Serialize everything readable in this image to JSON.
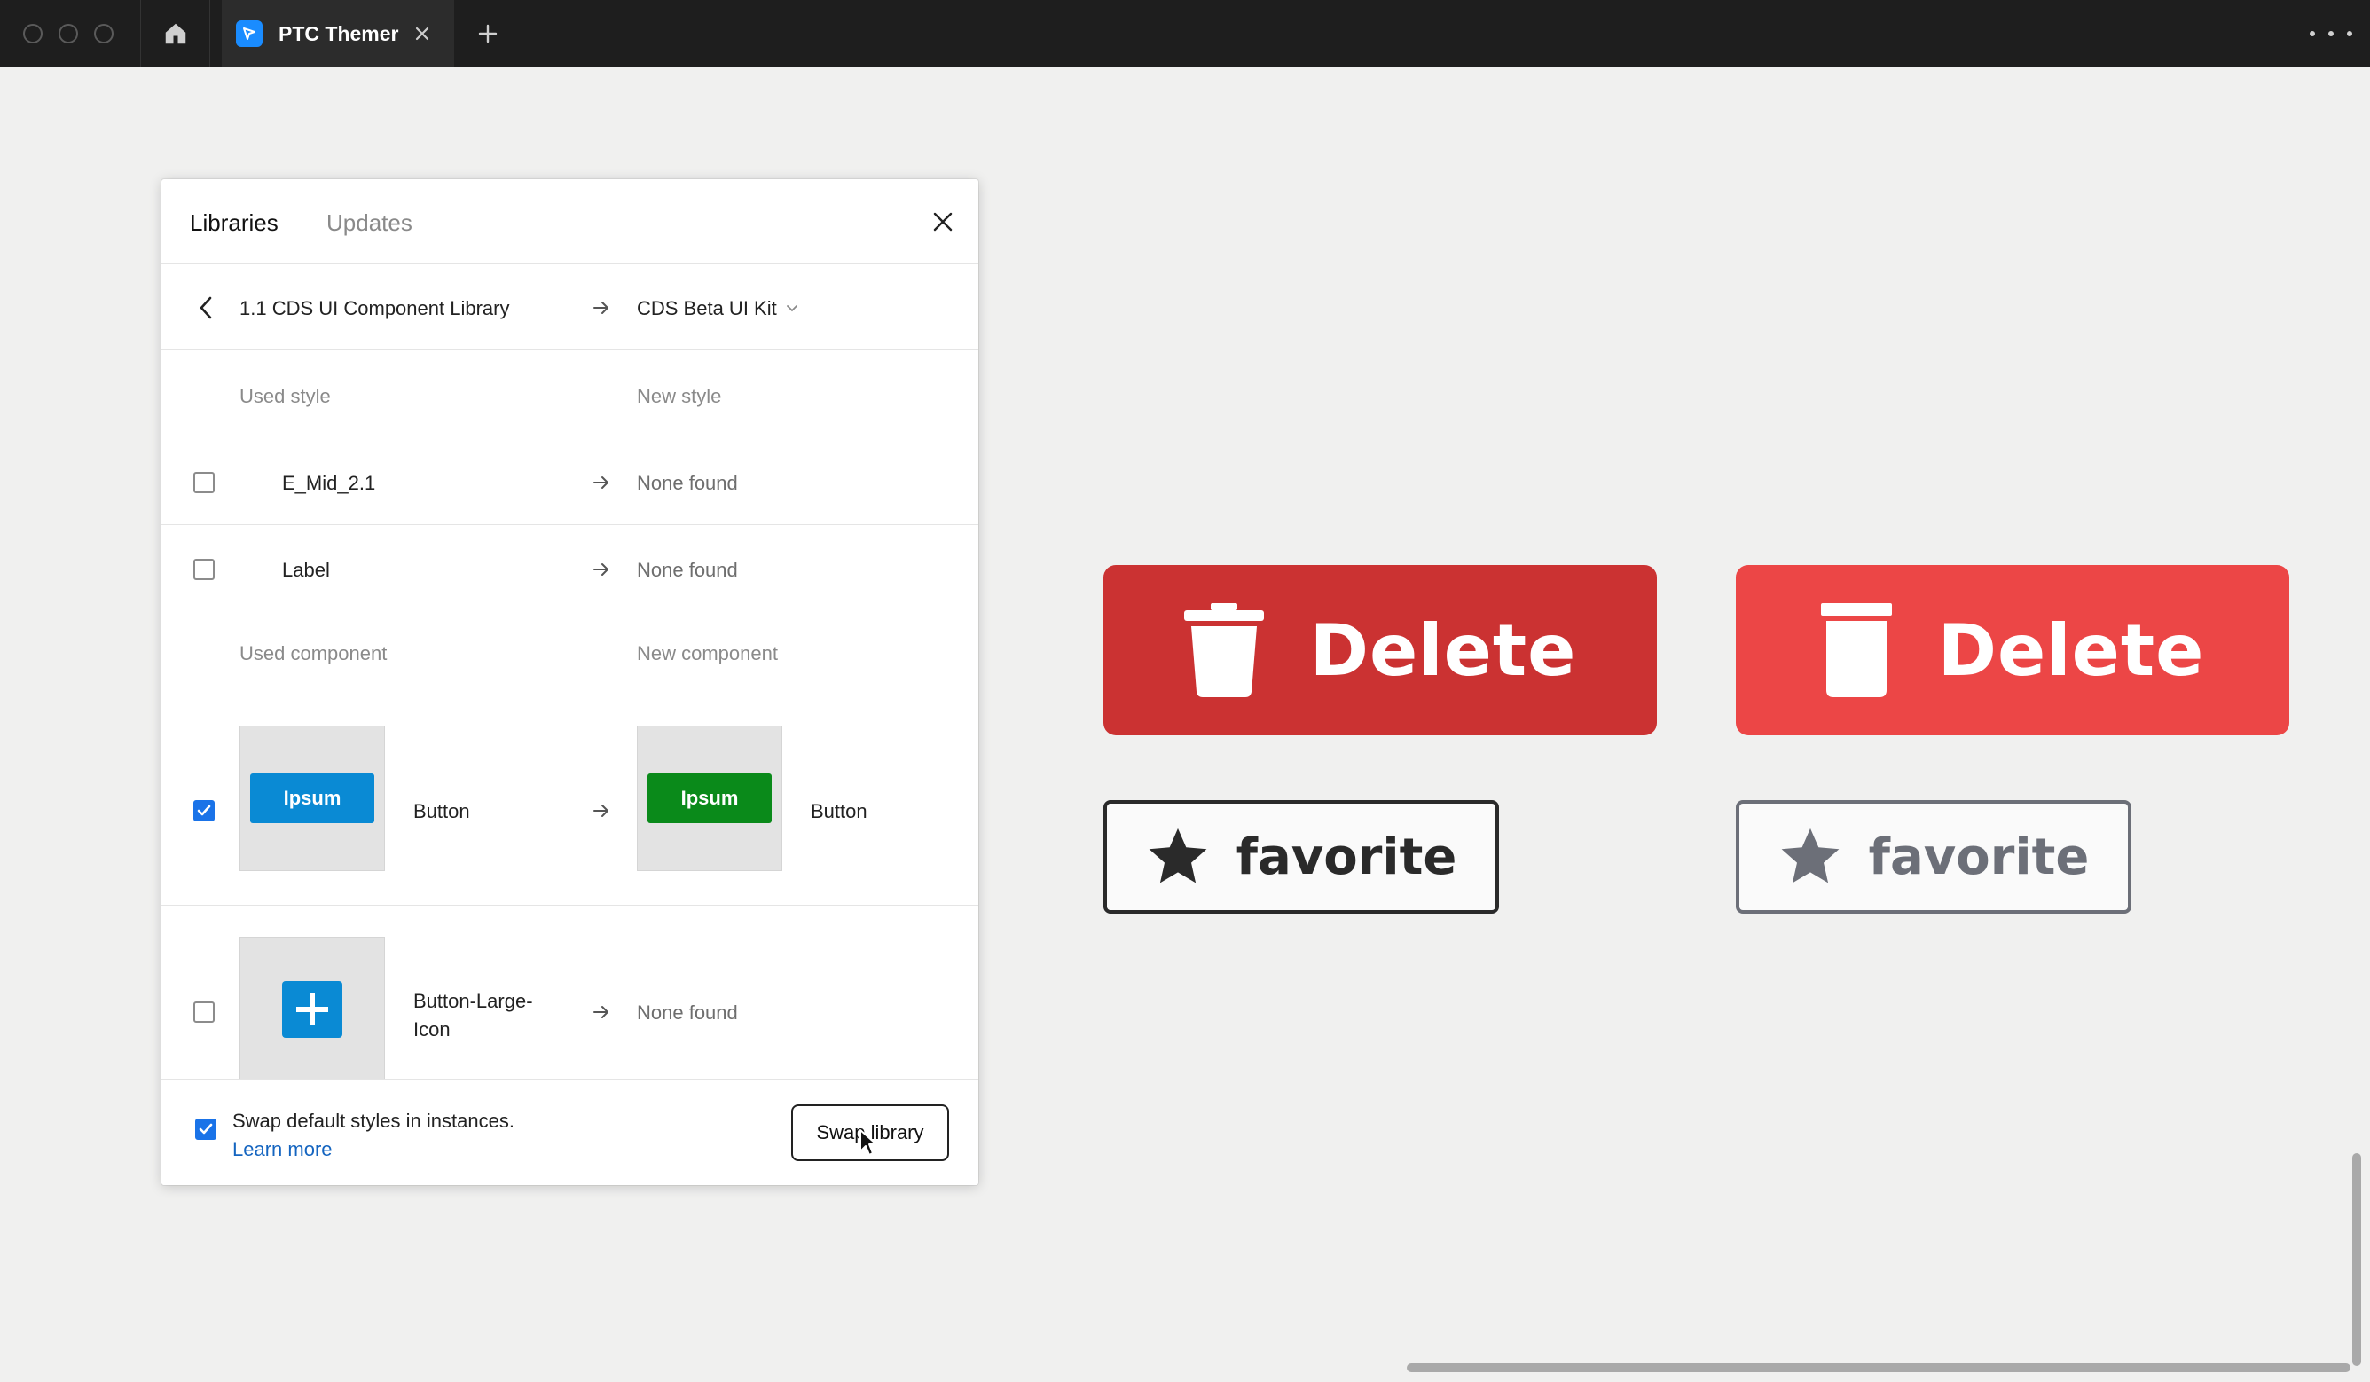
{
  "window": {
    "tab_title": "PTC Themer",
    "icons": [
      "home-icon",
      "close-icon",
      "plus-icon",
      "more-icon"
    ]
  },
  "panel": {
    "tabs": [
      {
        "label": "Libraries",
        "active": true
      },
      {
        "label": "Updates",
        "active": false
      }
    ],
    "from_library": "1.1 CDS UI Component Library",
    "to_library": "CDS Beta UI Kit",
    "styles_header": {
      "used": "Used style",
      "new": "New style"
    },
    "styles": [
      {
        "name": "E_Mid_2.1",
        "checked": false,
        "replacement": "None found"
      },
      {
        "name": "Label",
        "checked": false,
        "replacement": "None found"
      }
    ],
    "components_header": {
      "used": "Used component",
      "new": "New component"
    },
    "components": [
      {
        "name": "Button",
        "checked": true,
        "thumb_text": "Ipsum",
        "replacement": "Button",
        "replacement_thumb_text": "Ipsum"
      },
      {
        "name": "Button-Large-Icon",
        "checked": false,
        "replacement": "None found"
      }
    ],
    "footer": {
      "swap_defaults_label": "Swap default styles in instances.",
      "swap_defaults_checked": true,
      "learn_more": "Learn more",
      "swap_button": "Swap library"
    }
  },
  "canvas": {
    "delete_buttons": [
      {
        "label": "Delete",
        "color": "#cb3232"
      },
      {
        "label": "Delete",
        "color": "#ec4646"
      }
    ],
    "favorite_buttons": [
      {
        "label": "favorite",
        "color": "#2a2a2a"
      },
      {
        "label": "favorite",
        "color": "#6c6f78"
      }
    ]
  }
}
